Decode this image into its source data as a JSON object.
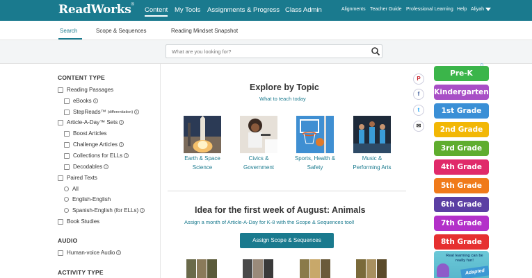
{
  "brand": {
    "logo": "ReadWorks",
    "registered": "®"
  },
  "topnav": {
    "main": [
      "Content",
      "My Tools",
      "Assignments & Progress",
      "Class Admin"
    ],
    "active": "Content",
    "right": [
      "Alignments",
      "Teacher Guide",
      "Professional Learning",
      "Help"
    ],
    "user": "Aliyah"
  },
  "subnav": {
    "tabs": [
      "Search",
      "Scope & Sequences",
      "Reading Mindset Snapshot"
    ],
    "active": "Search"
  },
  "search": {
    "placeholder": "What are you looking for?"
  },
  "sidebar": {
    "content_type_heading": "CONTENT TYPE",
    "filters": {
      "reading_passages": "Reading Passages",
      "ebooks": "eBooks",
      "steproads": "StepReads™",
      "steproads_note": "(differentiation)",
      "article_a_day": "Article-A-Day™ Sets",
      "boost": "Boost Articles",
      "challenge": "Challenge Articles",
      "collections": "Collections for ELLs",
      "decodables": "Decodables",
      "paired_texts": "Paired Texts",
      "all": "All",
      "english_english": "English-English",
      "spanish_english": "Spanish-English (for ELLs)",
      "book_studies": "Book Studies"
    },
    "audio_heading": "AUDIO",
    "audio": {
      "human_voice": "Human-voice Audio"
    },
    "activity_heading": "ACTIVITY TYPE"
  },
  "explore": {
    "title": "Explore by Topic",
    "subtitle": "What to teach today",
    "topics": [
      {
        "line1": "Earth & Space",
        "line2": "Science"
      },
      {
        "line1": "Civics &",
        "line2": "Government"
      },
      {
        "line1": "Sports, Health &",
        "line2": "Safety"
      },
      {
        "line1": "Music &",
        "line2": "Performing Arts"
      }
    ]
  },
  "idea": {
    "title": "Idea for the first week of August: Animals",
    "subtitle": "Assign a month of Article-A-Day for K-8 with the Scope & Sequences tool!",
    "button": "Assign Scope & Sequences"
  },
  "share": {
    "pinterest": "P",
    "facebook": "f",
    "twitter": "t",
    "email": "✉"
  },
  "grades": [
    {
      "label": "Pre-K",
      "color": "#3bb54a"
    },
    {
      "label": "Kindergarten",
      "color": "#a84fc6"
    },
    {
      "label": "1st Grade",
      "color": "#3a8fd6"
    },
    {
      "label": "2nd Grade",
      "color": "#f2b705"
    },
    {
      "label": "3rd Grade",
      "color": "#5fad2f"
    },
    {
      "label": "4th Grade",
      "color": "#e02a6a"
    },
    {
      "label": "5th Grade",
      "color": "#f07a1a"
    },
    {
      "label": "6th Grade",
      "color": "#5b3fa3"
    },
    {
      "label": "7th Grade",
      "color": "#b330c9"
    },
    {
      "label": "8th Grade",
      "color": "#e63030"
    }
  ],
  "ad": {
    "tag": "D",
    "text": "Real learning can be really fun!",
    "badge": "Adapted"
  }
}
